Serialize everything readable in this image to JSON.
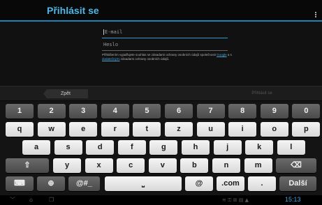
{
  "header": {
    "title": "Přihlásit se"
  },
  "form": {
    "email_placeholder": "E-mail",
    "password_placeholder": "Heslo",
    "legal_part1": "Přihlášením vyjadřujete souhlas se zásadami ochrany osobních údajů společnosti ",
    "legal_link1": "Google",
    "legal_part2": " a s ",
    "legal_link2": "dodatečnými",
    "legal_part3": " zásadami ochrany osobních údajů."
  },
  "nav": {
    "back_label": "Zpět",
    "signin_label": "Přihlásit se"
  },
  "keyboard": {
    "row1": [
      "1",
      "2",
      "3",
      "4",
      "5",
      "6",
      "7",
      "8",
      "9",
      "0"
    ],
    "row2": [
      "q",
      "w",
      "e",
      "r",
      "t",
      "z",
      "u",
      "i",
      "o",
      "p"
    ],
    "row3": [
      "a",
      "s",
      "d",
      "f",
      "g",
      "h",
      "j",
      "k",
      "l"
    ],
    "row4": [
      "y",
      "x",
      "c",
      "v",
      "b",
      "n",
      "m"
    ],
    "shift": "⇧",
    "backspace": "⌫",
    "keyboard_settings": "⌨",
    "globe": "⊕",
    "symbols": "@#_",
    "space": "⎵",
    "at": "@",
    "dotcom": ".com",
    "dot": ".",
    "next": "Další"
  },
  "system": {
    "clock": "15:13",
    "back_icon": "﹀",
    "home_icon": "⌂",
    "recent_icon": "❐",
    "status_icons": "≋ ⚿ ⊞ ▤ ▲"
  },
  "colors": {
    "accent": "#4db7e6",
    "accent_line": "#1e84b8"
  }
}
